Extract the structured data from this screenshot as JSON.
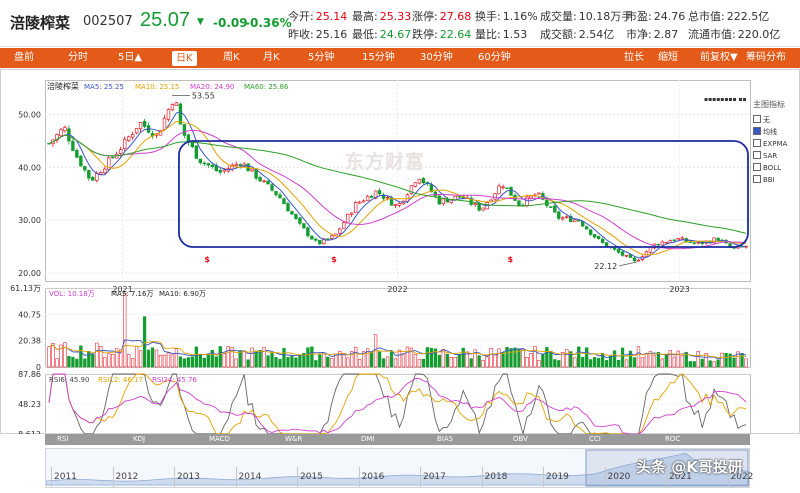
{
  "quote": {
    "name": "涪陵榨菜",
    "code": "002507",
    "price": "25.07",
    "arrow": "▼",
    "change": "-0.09",
    "change_pct": "-0.36%",
    "fields": [
      {
        "label": "今开:",
        "value": "25.14",
        "tone": "red"
      },
      {
        "label": "最高:",
        "value": "25.33",
        "tone": "red"
      },
      {
        "label": "涨停:",
        "value": "27.68",
        "tone": "red"
      },
      {
        "label": "换手:",
        "value": "1.16%",
        "tone": "plain"
      },
      {
        "label": "成交量:",
        "value": "10.18万手",
        "tone": "plain"
      },
      {
        "label": "市盈:",
        "value": "24.76",
        "tone": "plain"
      },
      {
        "label": "总市值:",
        "value": "222.5亿",
        "tone": "plain"
      },
      {
        "label": "昨收:",
        "value": "25.16",
        "tone": "plain"
      },
      {
        "label": "最低:",
        "value": "24.67",
        "tone": "green"
      },
      {
        "label": "跌停:",
        "value": "22.64",
        "tone": "green"
      },
      {
        "label": "量比:",
        "value": "1.53",
        "tone": "plain"
      },
      {
        "label": "成交额:",
        "value": "2.54亿",
        "tone": "plain"
      },
      {
        "label": "市净:",
        "value": "2.87",
        "tone": "plain"
      },
      {
        "label": "流通市值:",
        "value": "220.0亿",
        "tone": "plain"
      }
    ]
  },
  "toolbar": {
    "left_tabs": [
      "盘前",
      "分时",
      "5日▲",
      "日K",
      "周K",
      "月K",
      "5分钟",
      "15分钟",
      "30分钟",
      "60分钟"
    ],
    "active_tab": "日K",
    "right_tabs": [
      "拉长",
      "缩短",
      "前复权▼",
      "筹码分布"
    ]
  },
  "watermark": "东方财富",
  "author_mark": "头条 @K哥投研",
  "colors": {
    "up": "#e4000f",
    "down": "#139c30",
    "ma5": "#3a57c8",
    "ma10": "#e3a300",
    "ma20": "#d23fd0",
    "ma60": "#2fa02a",
    "highlight_box": "#1c2ba0",
    "accent": "#e45b19"
  },
  "indicator_panel": {
    "title": "主图指标",
    "items": [
      {
        "label": "无",
        "checked": false
      },
      {
        "label": "均线",
        "checked": true
      },
      {
        "label": "EXPMA",
        "checked": false
      },
      {
        "label": "SAR",
        "checked": false
      },
      {
        "label": "BOLL",
        "checked": false
      },
      {
        "label": "BBI",
        "checked": false
      }
    ]
  },
  "bottom_tabs": [
    "RSI",
    "KDJ",
    "MACD",
    "W&R",
    "DMI",
    "BIAS",
    "OBV",
    "CCI",
    "ROC"
  ],
  "timeline_years": [
    "2011",
    "2012",
    "2013",
    "2014",
    "2015",
    "2016",
    "2017",
    "2018",
    "2019",
    "2020",
    "2021",
    "2022"
  ],
  "chart_data": {
    "type": "candlestick",
    "title": "涪陵榨菜",
    "period": "日K",
    "x_ticks": [
      "2021",
      "2022",
      "2023"
    ],
    "y_ticks": [
      20.0,
      30.0,
      40.0,
      50.0
    ],
    "y_tick_labels": [
      "20.00",
      "30.00",
      "40.00",
      "50.00"
    ],
    "ylim": [
      18.5,
      56.5
    ],
    "annotations": {
      "max_price": 53.55,
      "min_price": 22.12
    },
    "legend": {
      "name": "涪陵榨菜",
      "ma5": "MA5: 25.25",
      "ma10": "MA10: 25.15",
      "ma20": "MA20: 24.90",
      "ma60": "MA60: 25.86"
    },
    "price_path": [
      {
        "pos": 0.0,
        "price": 44.5
      },
      {
        "pos": 0.022,
        "price": 47.5
      },
      {
        "pos": 0.04,
        "price": 42.0
      },
      {
        "pos": 0.06,
        "price": 37.5
      },
      {
        "pos": 0.085,
        "price": 41.0
      },
      {
        "pos": 0.105,
        "price": 44.0
      },
      {
        "pos": 0.13,
        "price": 48.5
      },
      {
        "pos": 0.155,
        "price": 46.0
      },
      {
        "pos": 0.18,
        "price": 53.55
      },
      {
        "pos": 0.19,
        "price": 47.0
      },
      {
        "pos": 0.215,
        "price": 41.5
      },
      {
        "pos": 0.245,
        "price": 39.0
      },
      {
        "pos": 0.275,
        "price": 41.0
      },
      {
        "pos": 0.3,
        "price": 38.0
      },
      {
        "pos": 0.33,
        "price": 34.5
      },
      {
        "pos": 0.36,
        "price": 29.0
      },
      {
        "pos": 0.385,
        "price": 25.5
      },
      {
        "pos": 0.41,
        "price": 27.0
      },
      {
        "pos": 0.44,
        "price": 33.0
      },
      {
        "pos": 0.47,
        "price": 35.5
      },
      {
        "pos": 0.5,
        "price": 32.5
      },
      {
        "pos": 0.53,
        "price": 38.5
      },
      {
        "pos": 0.56,
        "price": 33.5
      },
      {
        "pos": 0.59,
        "price": 34.5
      },
      {
        "pos": 0.62,
        "price": 32.0
      },
      {
        "pos": 0.65,
        "price": 37.0
      },
      {
        "pos": 0.675,
        "price": 33.0
      },
      {
        "pos": 0.7,
        "price": 35.0
      },
      {
        "pos": 0.73,
        "price": 30.5
      },
      {
        "pos": 0.76,
        "price": 30.0
      },
      {
        "pos": 0.79,
        "price": 26.0
      },
      {
        "pos": 0.815,
        "price": 24.0
      },
      {
        "pos": 0.84,
        "price": 22.12
      },
      {
        "pos": 0.87,
        "price": 25.5
      },
      {
        "pos": 0.9,
        "price": 26.5
      },
      {
        "pos": 0.93,
        "price": 25.5
      },
      {
        "pos": 0.96,
        "price": 26.5
      },
      {
        "pos": 0.98,
        "price": 24.5
      },
      {
        "pos": 1.0,
        "price": 25.07
      }
    ],
    "volume": {
      "legend": {
        "vol": "VOL: 10.18万",
        "ma5": "MA5: 7.16万",
        "ma10": "MA10: 6.90万"
      },
      "y_ticks": [
        0,
        20.38,
        40.75,
        61.13
      ],
      "y_tick_labels": [
        "0",
        "20.38",
        "40.75",
        "61.13万"
      ],
      "ylim": [
        0,
        61.13
      ],
      "unit": "万",
      "typical_max": 20.0,
      "spikes": [
        {
          "pos": 0.11,
          "value": 57.0
        },
        {
          "pos": 0.1,
          "value": 36.0
        },
        {
          "pos": 0.135,
          "value": 39.0
        },
        {
          "pos": 0.47,
          "value": 25.0
        },
        {
          "pos": 0.7,
          "value": 23.0
        },
        {
          "pos": 0.86,
          "value": 34.0
        },
        {
          "pos": 0.82,
          "value": 28.0
        }
      ]
    },
    "rsi": {
      "legend": {
        "rsi6": "RSI6: 45.90",
        "rsi12": "RSI12: 46.17",
        "rsi24": "RSI24: 45.76"
      },
      "y_ticks": [
        8.612,
        48.23,
        87.86
      ],
      "y_tick_labels": [
        "8.612",
        "48.23",
        "87.86"
      ],
      "ylim": [
        8.612,
        87.86
      ]
    }
  }
}
